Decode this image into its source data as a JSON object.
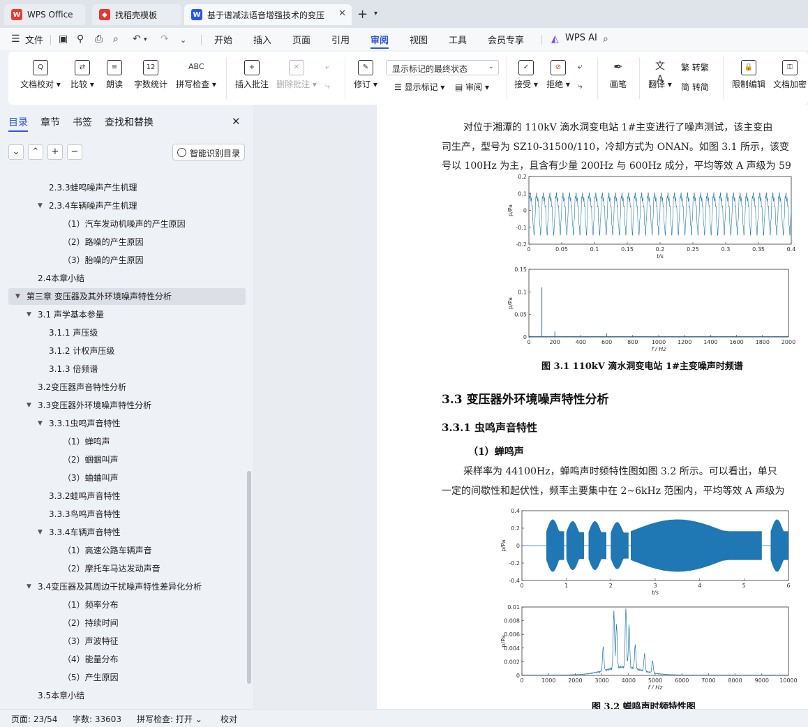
{
  "tabs": [
    {
      "label": "WPS Office",
      "icon": "wps-logo-icon"
    },
    {
      "label": "找稻壳模板",
      "icon": "docer-icon"
    },
    {
      "label": "基于谱减法语音增强技术的变压",
      "icon": "writer-doc-icon"
    }
  ],
  "menu": {
    "file": "文件",
    "items": [
      "开始",
      "插入",
      "页面",
      "引用",
      "审阅",
      "视图",
      "工具",
      "会员专享"
    ],
    "active": "审阅",
    "ai": "WPS AI"
  },
  "ribbon": {
    "proofread": "文档校对",
    "compare": "比较",
    "read_aloud": "朗读",
    "word_count": "字数统计",
    "spell_check": "拼写检查",
    "insert_comment": "插入批注",
    "delete_comment": "删除批注",
    "revise": "修订",
    "markup_mode": "显示标记的最终状态",
    "show_markup": "显示标记",
    "review": "审阅",
    "accept": "接受",
    "reject": "拒绝",
    "pen": "画笔",
    "translate": "翻译",
    "to_traditional": "转繁",
    "to_simplified": "转简",
    "restrict_edit": "限制编辑",
    "encrypt": "文档加密"
  },
  "nav": {
    "tabs": [
      "目录",
      "章节",
      "书签",
      "查找和替换"
    ],
    "active_tab": "目录",
    "smart_toc": "智能识别目录",
    "toc": [
      {
        "text": "2.3.3蛙鸣噪声产生机理",
        "level": 3,
        "arrow": false
      },
      {
        "text": "2.3.4车辆噪声产生机理",
        "level": 3,
        "arrow": true
      },
      {
        "text": "（1）汽车发动机噪声的产生原因",
        "level": 4,
        "arrow": false
      },
      {
        "text": "（2）路噪的产生原因",
        "level": 4,
        "arrow": false
      },
      {
        "text": "（3）胎噪的产生原因",
        "level": 4,
        "arrow": false
      },
      {
        "text": "2.4本章小结",
        "level": 2,
        "arrow": false
      },
      {
        "text": "第三章  变压器及其外环境噪声特性分析",
        "level": 1,
        "arrow": true,
        "selected": true
      },
      {
        "text": "3.1  声学基本参量",
        "level": 2,
        "arrow": true
      },
      {
        "text": "3.1.1  声压级",
        "level": 3,
        "arrow": false
      },
      {
        "text": "3.1.2  计权声压级",
        "level": 3,
        "arrow": false
      },
      {
        "text": "3.1.3  倍频谱",
        "level": 3,
        "arrow": false
      },
      {
        "text": "3.2变压器声音特性分析",
        "level": 2,
        "arrow": false
      },
      {
        "text": "3.3变压器外环境噪声特性分析",
        "level": 2,
        "arrow": true
      },
      {
        "text": "3.3.1虫鸣声音特性",
        "level": 3,
        "arrow": true
      },
      {
        "text": "（1）蝉鸣声",
        "level": 4,
        "arrow": false
      },
      {
        "text": "（2）蝈蝈叫声",
        "level": 4,
        "arrow": false
      },
      {
        "text": "（3）蛐蛐叫声",
        "level": 4,
        "arrow": false
      },
      {
        "text": "3.3.2蛙鸣声音特性",
        "level": 3,
        "arrow": false
      },
      {
        "text": "3.3.3鸟鸣声音特性",
        "level": 3,
        "arrow": false
      },
      {
        "text": "3.3.4车辆声音特性",
        "level": 3,
        "arrow": true
      },
      {
        "text": "（1）高速公路车辆声音",
        "level": 4,
        "arrow": false
      },
      {
        "text": "（2）摩托车马达发动声音",
        "level": 4,
        "arrow": false
      },
      {
        "text": "3.4变压器及其周边干扰噪声特性差异化分析",
        "level": 2,
        "arrow": true
      },
      {
        "text": "（1）频率分布",
        "level": 4,
        "arrow": false
      },
      {
        "text": "（2）持续时间",
        "level": 4,
        "arrow": false
      },
      {
        "text": "（3）声波特征",
        "level": 4,
        "arrow": false
      },
      {
        "text": "（4）能量分布",
        "level": 4,
        "arrow": false
      },
      {
        "text": "（5）产生原因",
        "level": 4,
        "arrow": false
      },
      {
        "text": "3.5本章小结",
        "level": 2,
        "arrow": false
      }
    ]
  },
  "doc": {
    "para1_line1": "对位于湘潭的 110kV 滴水洞变电站 1#主变进行了噪声测试，该主变由",
    "para1_line2": "司生产，型号为 SZ10-31500/110，冷却方式为 ONAN。如图 3.1 所示，该变",
    "para1_line3": "号以 100Hz 为主，且含有少量 200Hz 与 600Hz 成分，平均等效 A 声级为 59",
    "fig1_caption": "图 3.1 110kV 滴水洞变电站 1#主变噪声时频谱",
    "h2": "3.3  变压器外环境噪声特性分析",
    "h3": "3.3.1  虫鸣声音特性",
    "h4": "（1）蝉鸣声",
    "para2_line1": "采样率为 44100Hz，蝉鸣声时频特性图如图 3.2 所示。可以看出，单只",
    "para2_line2": "一定的间歇性和起伏性，频率主要集中在 2~6kHz 范围内，平均等效 A 声级为",
    "fig2_caption": "图 3.2  蝉鸣声时频特性图"
  },
  "chart_data": [
    {
      "type": "line",
      "title": "",
      "xlabel": "t/s",
      "ylabel": "p/Pa",
      "xlim": [
        0,
        0.4
      ],
      "ylim": [
        -0.2,
        0.2
      ],
      "xticks": [
        "0",
        "0.05",
        "0.1",
        "0.15",
        "0.2",
        "0.25",
        "0.3",
        "0.35",
        "0.4"
      ],
      "yticks": [
        "0.2",
        "0.1",
        "0",
        "-0.1",
        "-0.2"
      ],
      "series": [
        {
          "description": "periodic transformer waveform, 100 Hz dominant",
          "fundamental_hz": 100,
          "amplitude": 0.15
        }
      ]
    },
    {
      "type": "line",
      "title": "",
      "xlabel": "f / Hz",
      "ylabel": "p/Pa",
      "xlim": [
        0,
        2000
      ],
      "ylim": [
        0,
        0.15
      ],
      "xticks": [
        "0",
        "200",
        "400",
        "600",
        "800",
        "1000",
        "1200",
        "1400",
        "1600",
        "1800",
        "2000"
      ],
      "yticks": [
        "0.15",
        "0.1",
        "0.05",
        "0"
      ],
      "peaks": [
        {
          "x": 100,
          "y": 0.11
        },
        {
          "x": 200,
          "y": 0.012
        },
        {
          "x": 600,
          "y": 0.008
        }
      ]
    },
    {
      "type": "line",
      "title": "",
      "xlabel": "t/s",
      "ylabel": "p/Pa",
      "xlim": [
        0,
        6
      ],
      "ylim": [
        -0.4,
        0.4
      ],
      "xticks": [
        "0",
        "1",
        "2",
        "3",
        "4",
        "5",
        "6"
      ],
      "yticks": [
        "0.4",
        "0.2",
        "0",
        "-0.2",
        "-0.4"
      ],
      "bursts": [
        [
          0.55,
          0.95,
          0.3
        ],
        [
          1.0,
          1.4,
          0.28
        ],
        [
          1.5,
          1.9,
          0.28
        ],
        [
          2.0,
          2.4,
          0.27
        ],
        [
          2.45,
          5.4,
          0.3
        ],
        [
          5.6,
          6.0,
          0.3
        ]
      ]
    },
    {
      "type": "line",
      "title": "",
      "xlabel": "f / Hz",
      "ylabel": "p/Pa",
      "xlim": [
        0,
        10000
      ],
      "ylim": [
        0,
        0.01
      ],
      "xticks": [
        "0",
        "1000",
        "2000",
        "3000",
        "4000",
        "5000",
        "6000",
        "7000",
        "8000",
        "9000",
        "10000"
      ],
      "yticks": [
        "0.01",
        "0.008",
        "0.006",
        "0.004",
        "0.002",
        "0"
      ],
      "peaks": [
        {
          "x": 3050,
          "y": 0.0037
        },
        {
          "x": 3450,
          "y": 0.0085
        },
        {
          "x": 3550,
          "y": 0.0065
        },
        {
          "x": 3900,
          "y": 0.0088
        },
        {
          "x": 4020,
          "y": 0.0062
        },
        {
          "x": 4250,
          "y": 0.0035
        },
        {
          "x": 4600,
          "y": 0.0025
        },
        {
          "x": 4900,
          "y": 0.0018
        }
      ]
    }
  ],
  "status": {
    "page": "页面: 23/54",
    "words": "字数: 33603",
    "spell": "拼写检查: 打开",
    "proof": "校对"
  },
  "colors": {
    "accent": "#2a55e5",
    "plot_line": "#1f77b4"
  }
}
